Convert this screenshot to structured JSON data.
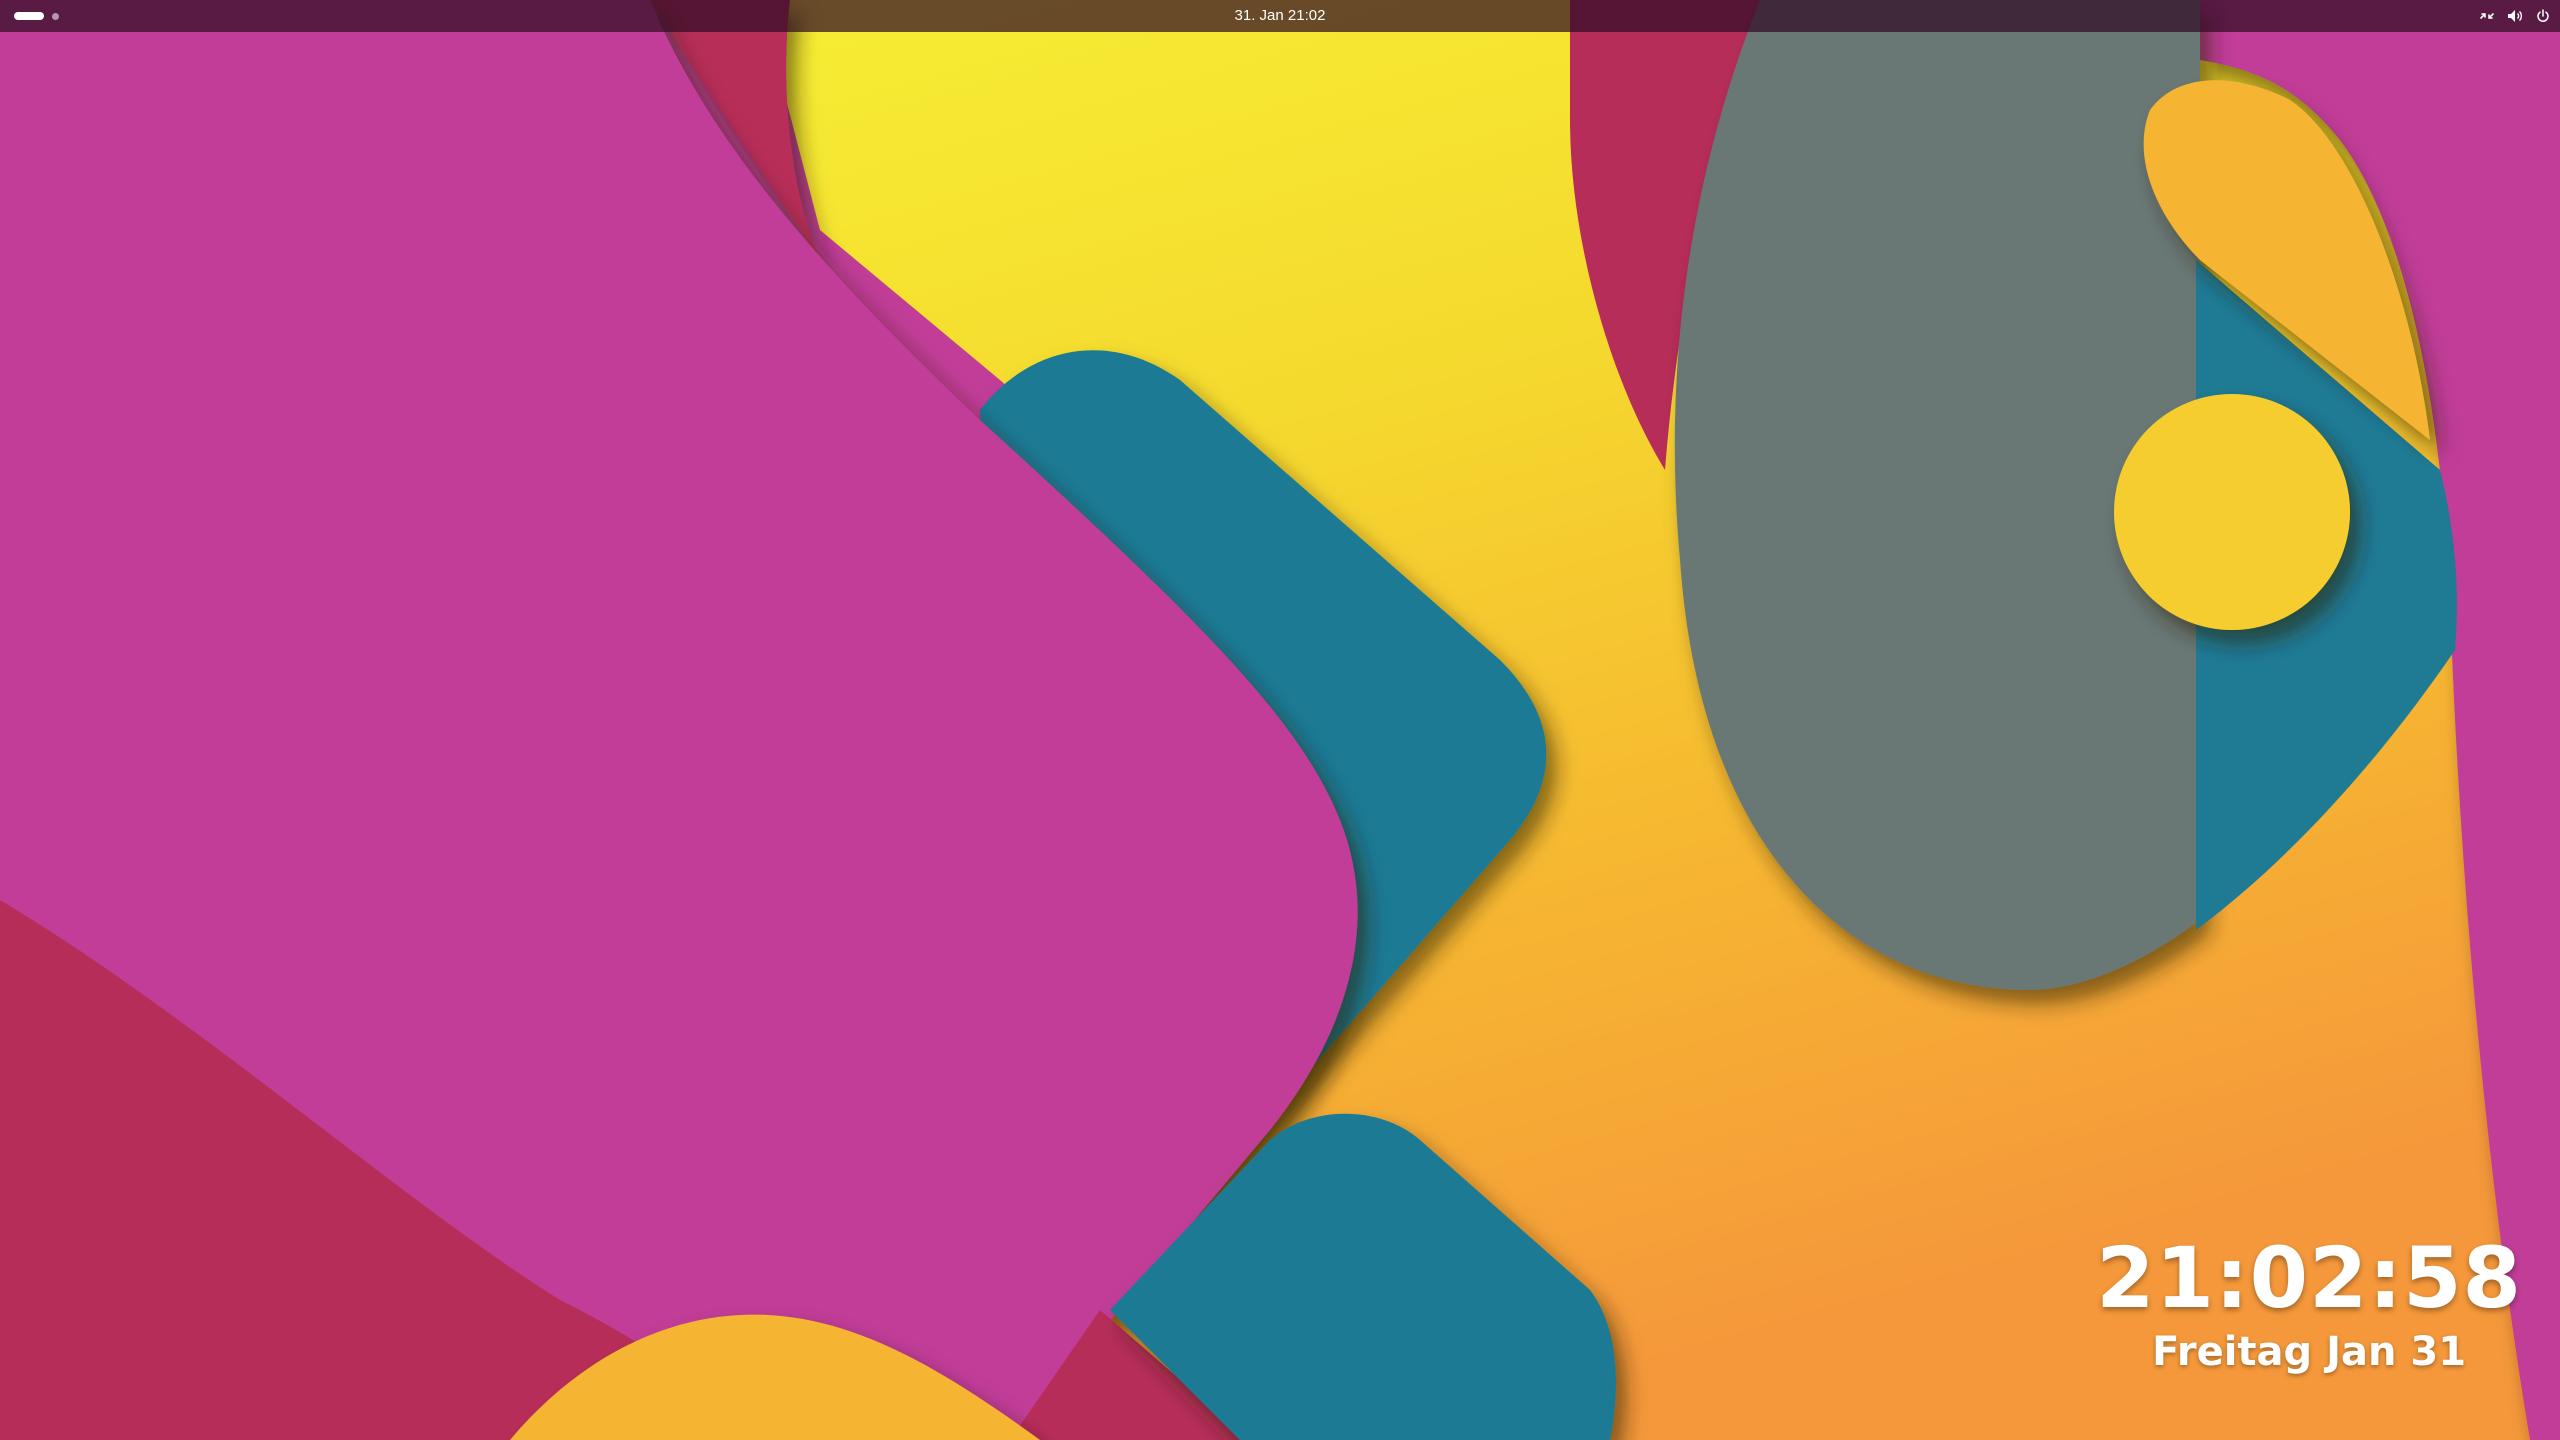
{
  "top_bar": {
    "clock": "31. Jan  21:02",
    "icons": [
      "network-icon",
      "volume-icon",
      "power-icon"
    ]
  },
  "desktop_clock": {
    "time": "21:02:58",
    "date": "Freitag Jan 31"
  },
  "wallpaper": {
    "colors": {
      "magenta": "#c13d97",
      "crimson": "#b72d59",
      "yellow": "#f6e934",
      "orange": "#f5a03c",
      "teal": "#1f7a94",
      "gray": "#6b7874"
    }
  }
}
